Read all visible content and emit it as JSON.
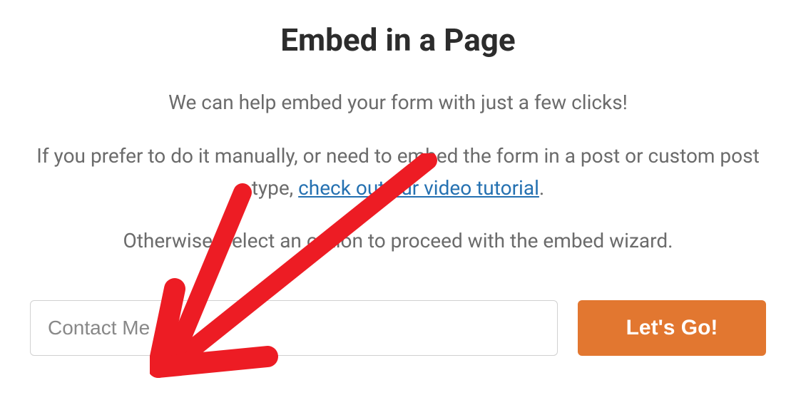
{
  "modal": {
    "title": "Embed in a Page",
    "description_line1": "We can help embed your form with just a few clicks!",
    "description_line2_pre": "If you prefer to do it manually, or need to embed the form in a post or custom post type, ",
    "description_line2_link": "check out our video tutorial",
    "description_line2_post": ".",
    "description_line3": "Otherwise, select an option to proceed with the embed wizard.",
    "input_value": "Contact Me",
    "button_label": "Let's Go!"
  }
}
